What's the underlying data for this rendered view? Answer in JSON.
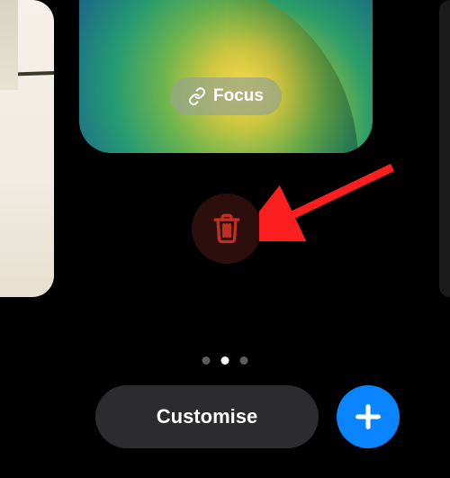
{
  "focus": {
    "label": "Focus"
  },
  "buttons": {
    "customise_label": "Customise"
  },
  "pager": {
    "count": 3,
    "active_index": 1
  },
  "colors": {
    "accent_blue": "#0a84ff",
    "delete_red": "#c0392b"
  }
}
